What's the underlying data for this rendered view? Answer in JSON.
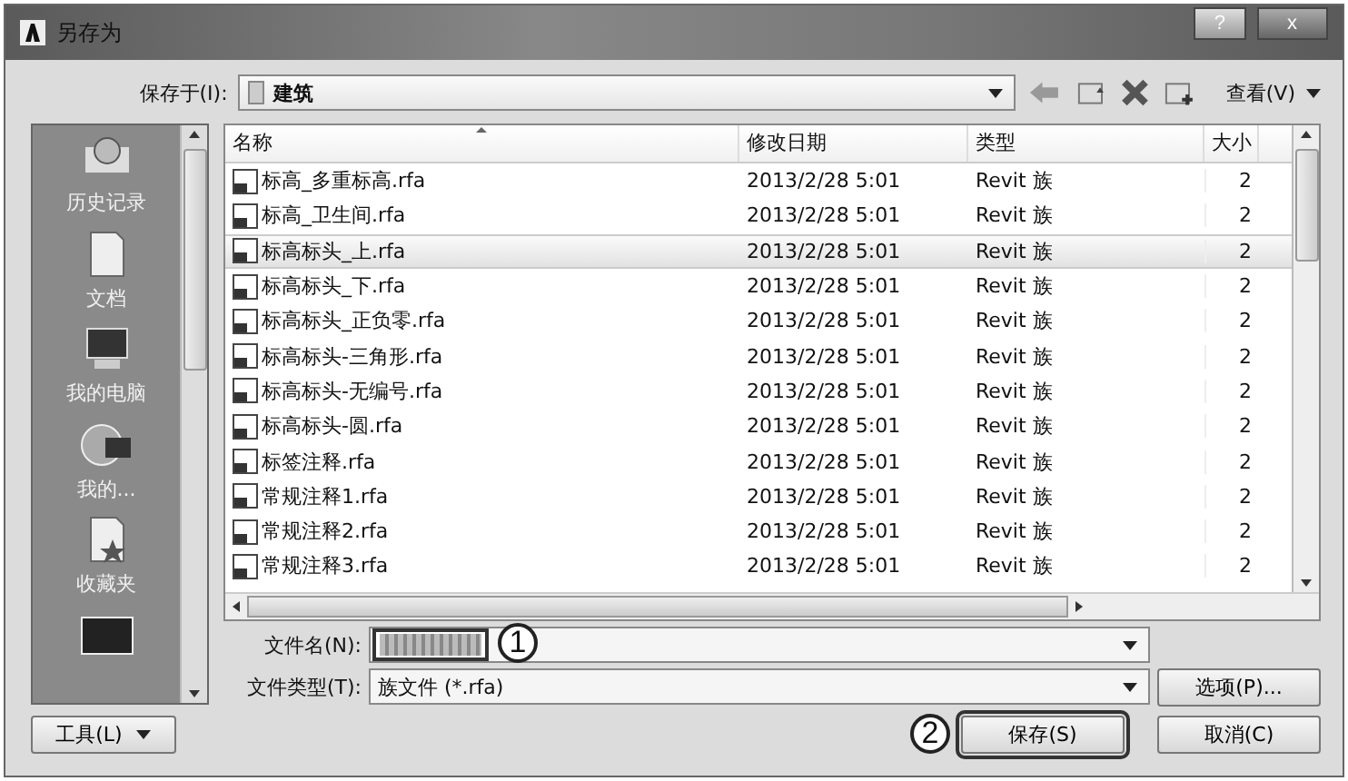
{
  "window": {
    "title": "另存为",
    "help_button": "?",
    "close_button": "x"
  },
  "toolbar": {
    "save_in_label": "保存于(I):",
    "location": "建筑",
    "view_menu": "查看(V)"
  },
  "sidebar": {
    "items": [
      {
        "label": "历史记录",
        "kind": "history"
      },
      {
        "label": "文档",
        "kind": "documents"
      },
      {
        "label": "我的电脑",
        "kind": "computer"
      },
      {
        "label": "我的...",
        "kind": "network"
      },
      {
        "label": "收藏夹",
        "kind": "favorites"
      },
      {
        "kind": "desktop"
      }
    ]
  },
  "file_list": {
    "columns": [
      "名称",
      "修改日期",
      "类型",
      "大小"
    ],
    "rows": [
      {
        "name": "标高_多重标高.rfa",
        "modified": "2013/2/28 5:01",
        "type": "Revit 族",
        "size": "2",
        "selected": false
      },
      {
        "name": "标高_卫生间.rfa",
        "modified": "2013/2/28 5:01",
        "type": "Revit 族",
        "size": "2",
        "selected": false
      },
      {
        "name": "标高标头_上.rfa",
        "modified": "2013/2/28 5:01",
        "type": "Revit 族",
        "size": "2",
        "selected": true
      },
      {
        "name": "标高标头_下.rfa",
        "modified": "2013/2/28 5:01",
        "type": "Revit 族",
        "size": "2",
        "selected": false
      },
      {
        "name": "标高标头_正负零.rfa",
        "modified": "2013/2/28 5:01",
        "type": "Revit 族",
        "size": "2",
        "selected": false
      },
      {
        "name": "标高标头-三角形.rfa",
        "modified": "2013/2/28 5:01",
        "type": "Revit 族",
        "size": "2",
        "selected": false
      },
      {
        "name": "标高标头-无编号.rfa",
        "modified": "2013/2/28 5:01",
        "type": "Revit 族",
        "size": "2",
        "selected": false
      },
      {
        "name": "标高标头-圆.rfa",
        "modified": "2013/2/28 5:01",
        "type": "Revit 族",
        "size": "2",
        "selected": false
      },
      {
        "name": "标签注释.rfa",
        "modified": "2013/2/28 5:01",
        "type": "Revit 族",
        "size": "2",
        "selected": false
      },
      {
        "name": "常规注释1.rfa",
        "modified": "2013/2/28 5:01",
        "type": "Revit 族",
        "size": "2",
        "selected": false
      },
      {
        "name": "常规注释2.rfa",
        "modified": "2013/2/28 5:01",
        "type": "Revit 族",
        "size": "2",
        "selected": false
      },
      {
        "name": "常规注释3.rfa",
        "modified": "2013/2/28 5:01",
        "type": "Revit 族",
        "size": "2",
        "selected": false
      }
    ]
  },
  "file_name": {
    "label": "文件名(N):"
  },
  "file_type": {
    "label": "文件类型(T):",
    "value": "族文件 (*.rfa)"
  },
  "buttons": {
    "options": "选项(P)...",
    "tools": "工具(L)",
    "save": "保存(S)",
    "cancel": "取消(C)"
  },
  "callouts": [
    {
      "label": "1"
    },
    {
      "label": "2"
    }
  ]
}
